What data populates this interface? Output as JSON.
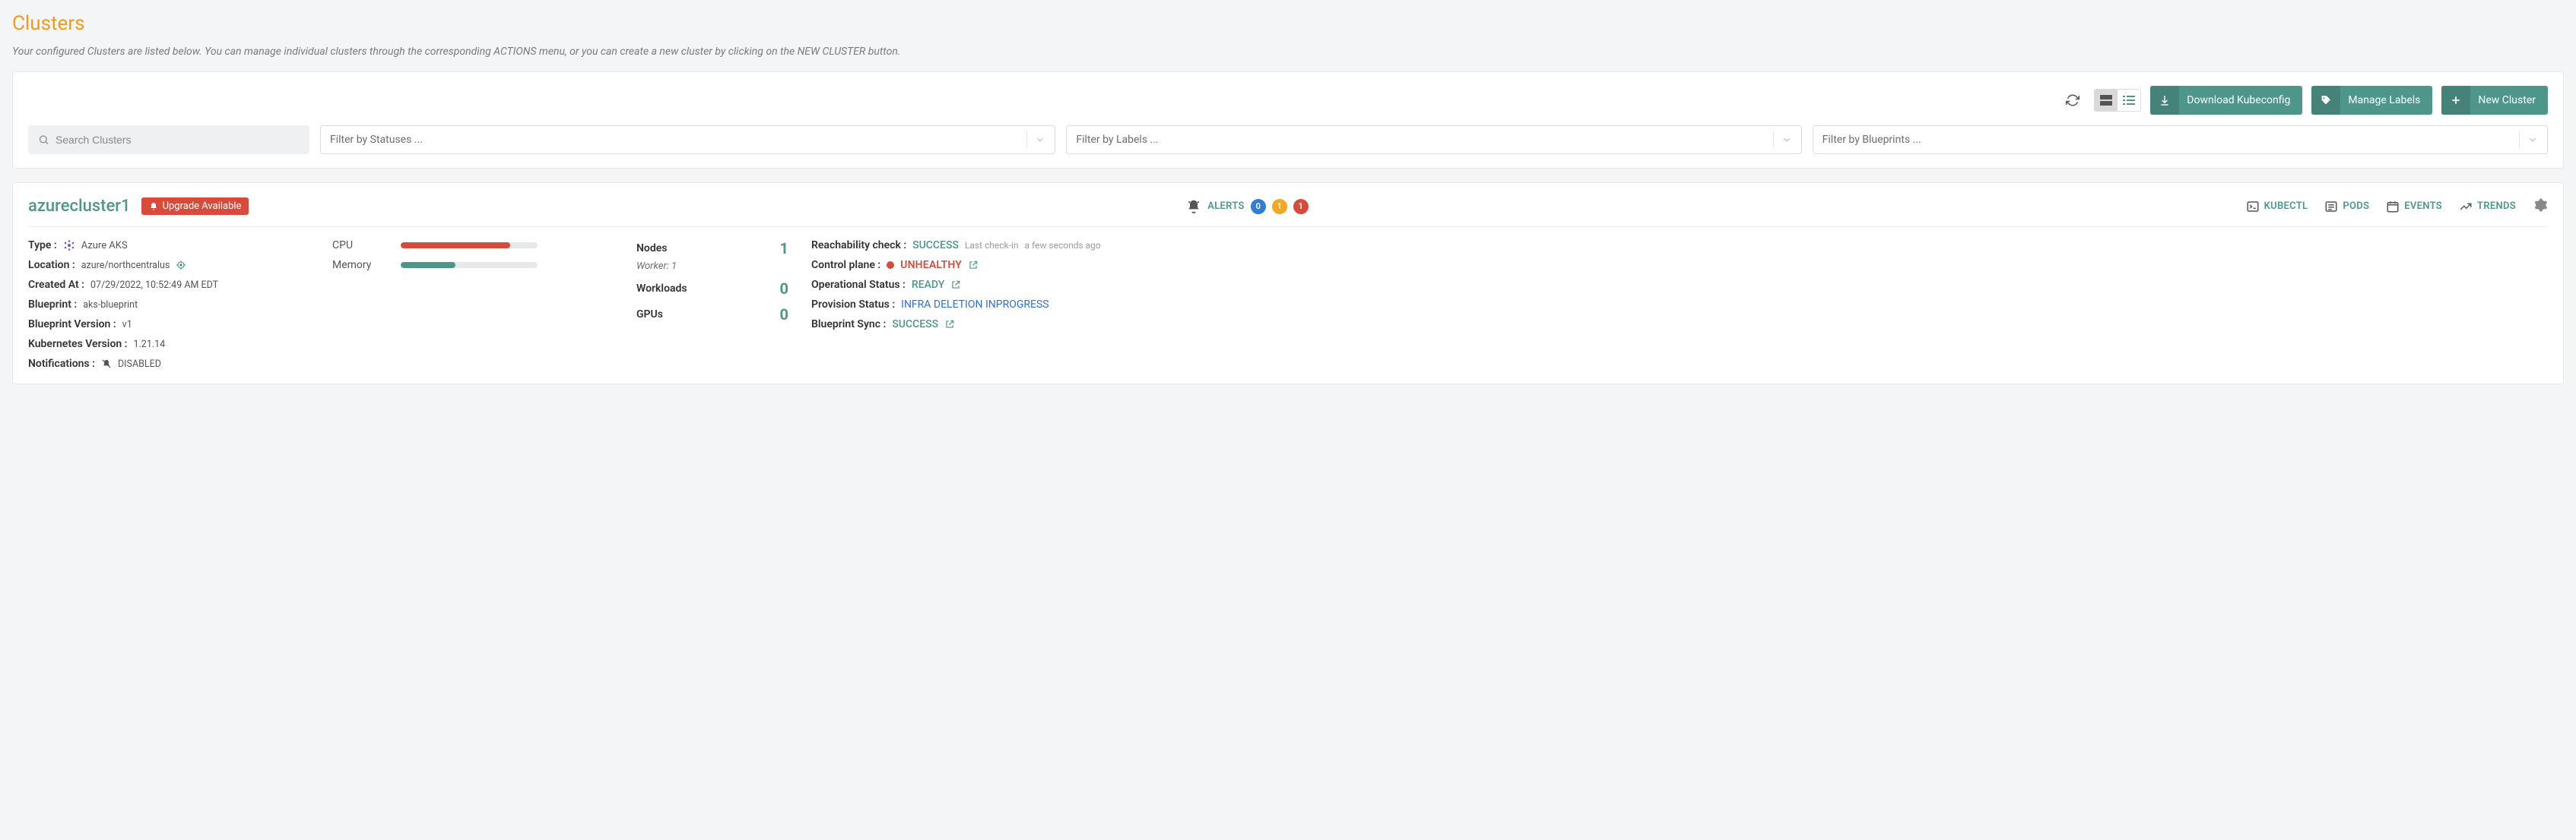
{
  "page": {
    "title": "Clusters",
    "subtitle": "Your configured Clusters are listed below. You can manage individual clusters through the corresponding ACTIONS menu, or you can create a new cluster by clicking on the NEW CLUSTER button."
  },
  "toolbar": {
    "download_label": "Download Kubeconfig",
    "manage_labels_label": "Manage Labels",
    "new_cluster_label": "New Cluster"
  },
  "filters": {
    "search_placeholder": "Search Clusters",
    "status_placeholder": "Filter by Statuses ...",
    "labels_placeholder": "Filter by Labels ...",
    "blueprints_placeholder": "Filter by Blueprints ..."
  },
  "cluster": {
    "name": "azurecluster1",
    "upgrade_badge": "Upgrade Available",
    "alerts": {
      "label": "ALERTS",
      "info": "0",
      "warn": "1",
      "crit": "1"
    },
    "tabs": {
      "kubectl": "KUBECTL",
      "pods": "PODS",
      "events": "EVENTS",
      "trends": "TRENDS"
    },
    "details": {
      "type_label": "Type :",
      "type_value": "Azure AKS",
      "location_label": "Location :",
      "location_value": "azure/northcentralus",
      "created_label": "Created At :",
      "created_value": "07/29/2022, 10:52:49 AM EDT",
      "blueprint_label": "Blueprint :",
      "blueprint_value": "aks-blueprint",
      "bp_version_label": "Blueprint Version :",
      "bp_version_value": "v1",
      "k8s_version_label": "Kubernetes Version :",
      "k8s_version_value": "1.21.14",
      "notifications_label": "Notifications :",
      "notifications_value": "DISABLED"
    },
    "resources": {
      "cpu_label": "CPU",
      "cpu_pct": 80,
      "mem_label": "Memory",
      "mem_pct": 40
    },
    "stats": {
      "nodes_label": "Nodes",
      "nodes_value": "1",
      "worker_label": "Worker: 1",
      "workloads_label": "Workloads",
      "workloads_value": "0",
      "gpus_label": "GPUs",
      "gpus_value": "0"
    },
    "status": {
      "reach_label": "Reachability check :",
      "reach_value": "SUCCESS",
      "reach_sub_a": "Last check-in",
      "reach_sub_b": "a few seconds ago",
      "cp_label": "Control plane :",
      "cp_value": "UNHEALTHY",
      "op_label": "Operational Status :",
      "op_value": "READY",
      "prov_label": "Provision Status :",
      "prov_value": "INFRA DELETION INPROGRESS",
      "bp_sync_label": "Blueprint Sync :",
      "bp_sync_value": "SUCCESS"
    }
  }
}
